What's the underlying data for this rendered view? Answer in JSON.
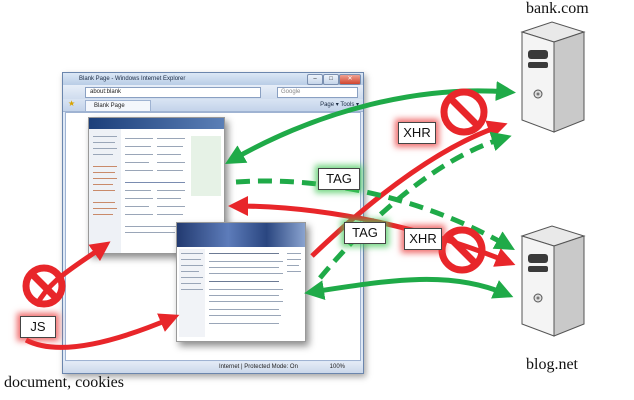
{
  "servers": {
    "bank": {
      "label": "bank.com",
      "icon": "server-icon"
    },
    "blog": {
      "label": "blog.net",
      "icon": "server-icon"
    }
  },
  "browser": {
    "title": "Blank Page - Windows Internet Explorer",
    "address": "about:blank",
    "search_placeholder": "Google",
    "tab_label": "Blank Page",
    "toolbar": "Page ▾  Tools ▾",
    "status": "Internet | Protected Mode: On",
    "zoom": "100%"
  },
  "labels": {
    "xhr_top": "XHR",
    "xhr_bottom": "XHR",
    "tag_top": "TAG",
    "tag_bottom": "TAG",
    "js": "JS"
  },
  "caption": "document, cookies",
  "colors": {
    "allowed": "#1faa48",
    "blocked": "#e8262a",
    "forbidden_sign": "#e8262a"
  }
}
